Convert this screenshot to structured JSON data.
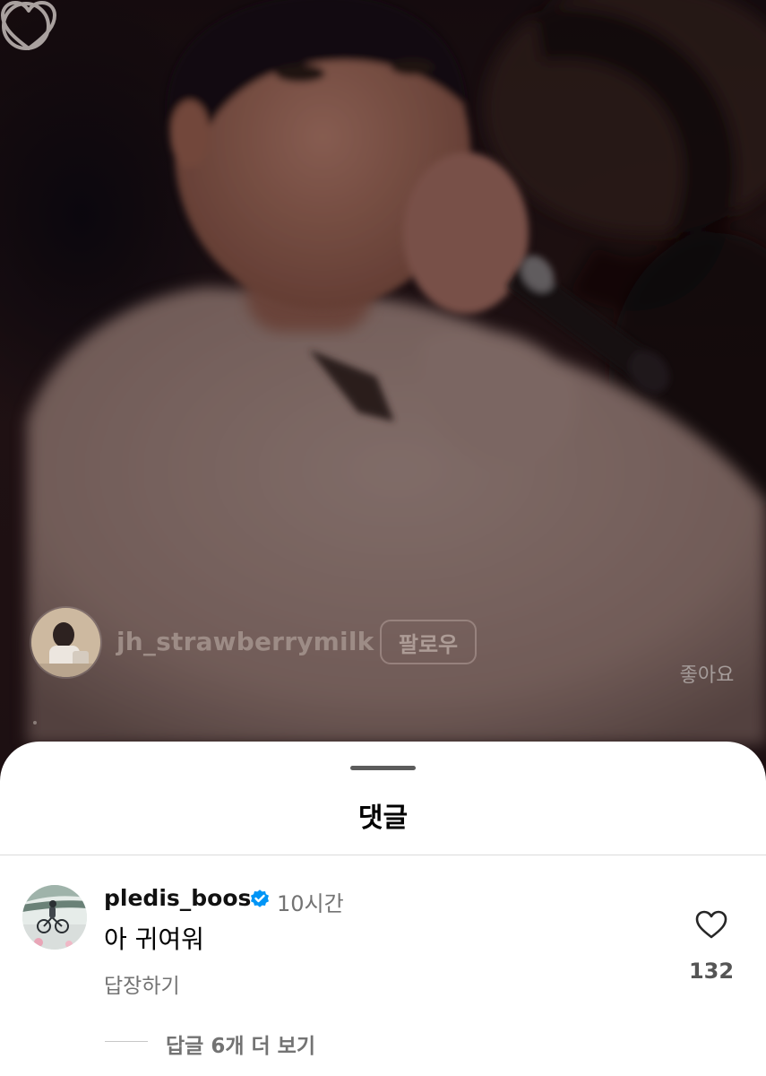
{
  "reel": {
    "author_username": "jh_strawberrymilk",
    "follow_label": "팔로우",
    "like_label": "좋아요"
  },
  "comments_sheet": {
    "title": "댓글",
    "comment": {
      "username": "pledis_boos",
      "verified": true,
      "time": "10시간",
      "text": "아 귀여워",
      "reply_label": "답장하기",
      "like_count": "132"
    },
    "view_more_replies": "답글 6개 더 보기"
  },
  "colors": {
    "verified_blue": "#0095f6",
    "sheet_background": "#ffffff"
  },
  "icons": {
    "reel_like": "heart-outline-icon",
    "reel_comment": "comment-icon",
    "comment_like": "heart-outline-icon",
    "verified": "verified-badge-icon"
  }
}
